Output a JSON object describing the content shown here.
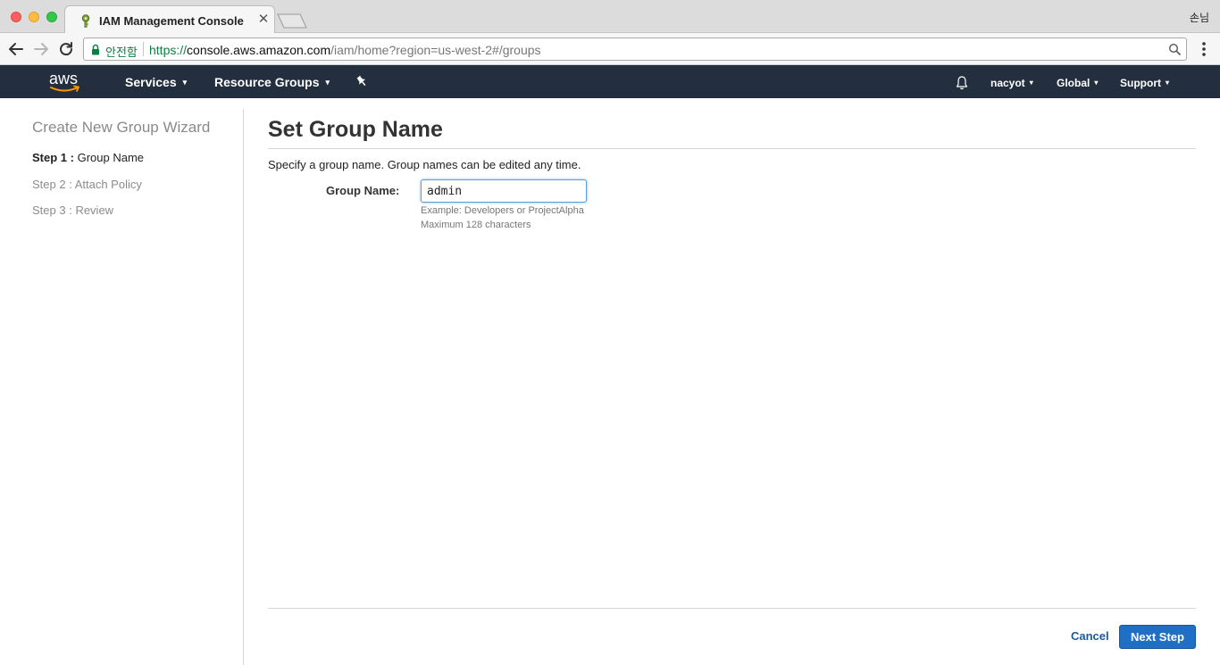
{
  "browser": {
    "tab_title": "IAM Management Console",
    "tab_close": "✕",
    "profile_name": "손님",
    "secure_label": "안전함",
    "url_scheme": "https://",
    "url_host": "console.aws.amazon.com",
    "url_path": "/iam/home?region=us-west-2#/groups",
    "icons": [
      "back-arrow-icon",
      "forward-arrow-icon",
      "reload-icon",
      "lock-icon",
      "search-icon",
      "menu-dots-icon"
    ]
  },
  "aws_nav": {
    "logo_text": "aws",
    "services": "Services",
    "resource_groups": "Resource Groups",
    "user": "nacyot",
    "region": "Global",
    "support": "Support",
    "caret": "▾",
    "icons": [
      "pin-icon",
      "bell-icon"
    ],
    "colors": {
      "background": "#232f3e",
      "logo_smile": "#ff9900"
    }
  },
  "wizard": {
    "title": "Create New Group Wizard",
    "steps": [
      {
        "num": "Step 1 :",
        "label": "Group Name",
        "active": true
      },
      {
        "num": "Step 2 :",
        "label": "Attach Policy",
        "active": false
      },
      {
        "num": "Step 3 :",
        "label": "Review",
        "active": false
      }
    ]
  },
  "main": {
    "title": "Set Group Name",
    "description": "Specify a group name. Group names can be edited any time.",
    "field_label": "Group Name:",
    "field_value": "admin",
    "hint_example": "Example: Developers or ProjectAlpha",
    "hint_max": "Maximum 128 characters",
    "cancel_label": "Cancel",
    "next_label": "Next Step",
    "colors": {
      "primary_button": "#1f6fc7",
      "link": "#1a5a9e"
    }
  }
}
